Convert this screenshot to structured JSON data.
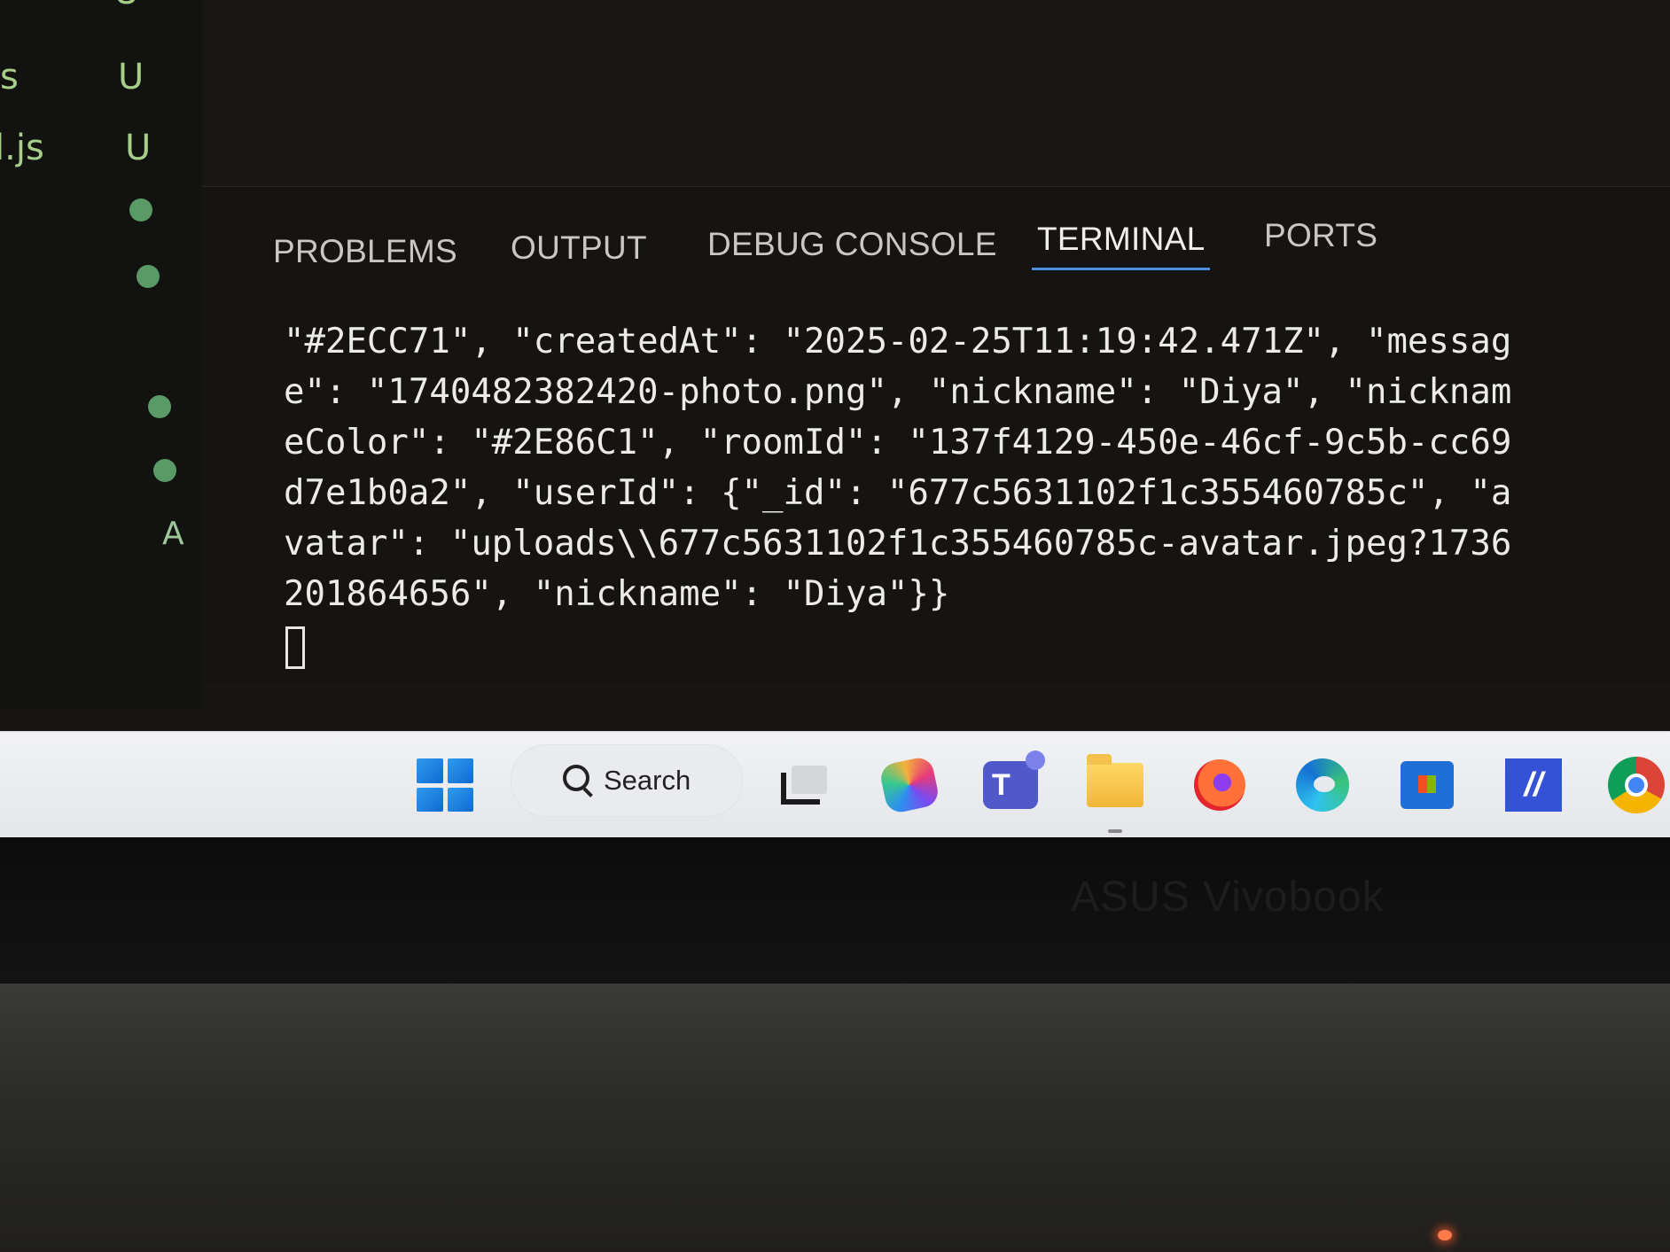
{
  "explorer": {
    "files": [
      {
        "name": "",
        "status": "U"
      },
      {
        "name": "s",
        "status": "U"
      },
      {
        "name": "l.js",
        "status": "U"
      }
    ],
    "added_marker": "A"
  },
  "panel": {
    "tabs": [
      {
        "label": "PROBLEMS"
      },
      {
        "label": "OUTPUT"
      },
      {
        "label": "DEBUG CONSOLE"
      },
      {
        "label": "TERMINAL",
        "active": true
      },
      {
        "label": "PORTS"
      }
    ],
    "terminal_lines": [
      "\"#2ECC71\", \"createdAt\": \"2025-02-25T11:19:42.471Z\", \"messag",
      "e\": \"1740482382420-photo.png\", \"nickname\": \"Diya\", \"nicknam",
      "eColor\": \"#2E86C1\", \"roomId\": \"137f4129-450e-46cf-9c5b-cc69",
      "d7e1b0a2\", \"userId\": {\"_id\": \"677c5631102f1c355460785c\", \"a",
      "vatar\": \"uploads\\\\677c5631102f1c355460785c-avatar.jpeg?1736",
      "201864656\", \"nickname\": \"Diya\"}}"
    ]
  },
  "taskbar": {
    "search_label": "Search",
    "icons": [
      "start-icon",
      "task-view-icon",
      "copilot-icon",
      "teams-icon",
      "file-explorer-icon",
      "firefox-icon",
      "edge-icon",
      "microsoft-store-icon",
      "vscode-icon",
      "chrome-icon"
    ],
    "teams_letter": "T",
    "vscode_glyph": "//"
  },
  "device": {
    "brand": "ASUS Vivobook"
  },
  "colors": {
    "terminal_bg": "#151413",
    "terminal_text": "#ecebe6",
    "git_untracked": "#a7cf8a",
    "git_dot": "#5a9a66",
    "active_tab_underline": "#4d8fe0",
    "taskbar_bg": "#eceef1"
  }
}
